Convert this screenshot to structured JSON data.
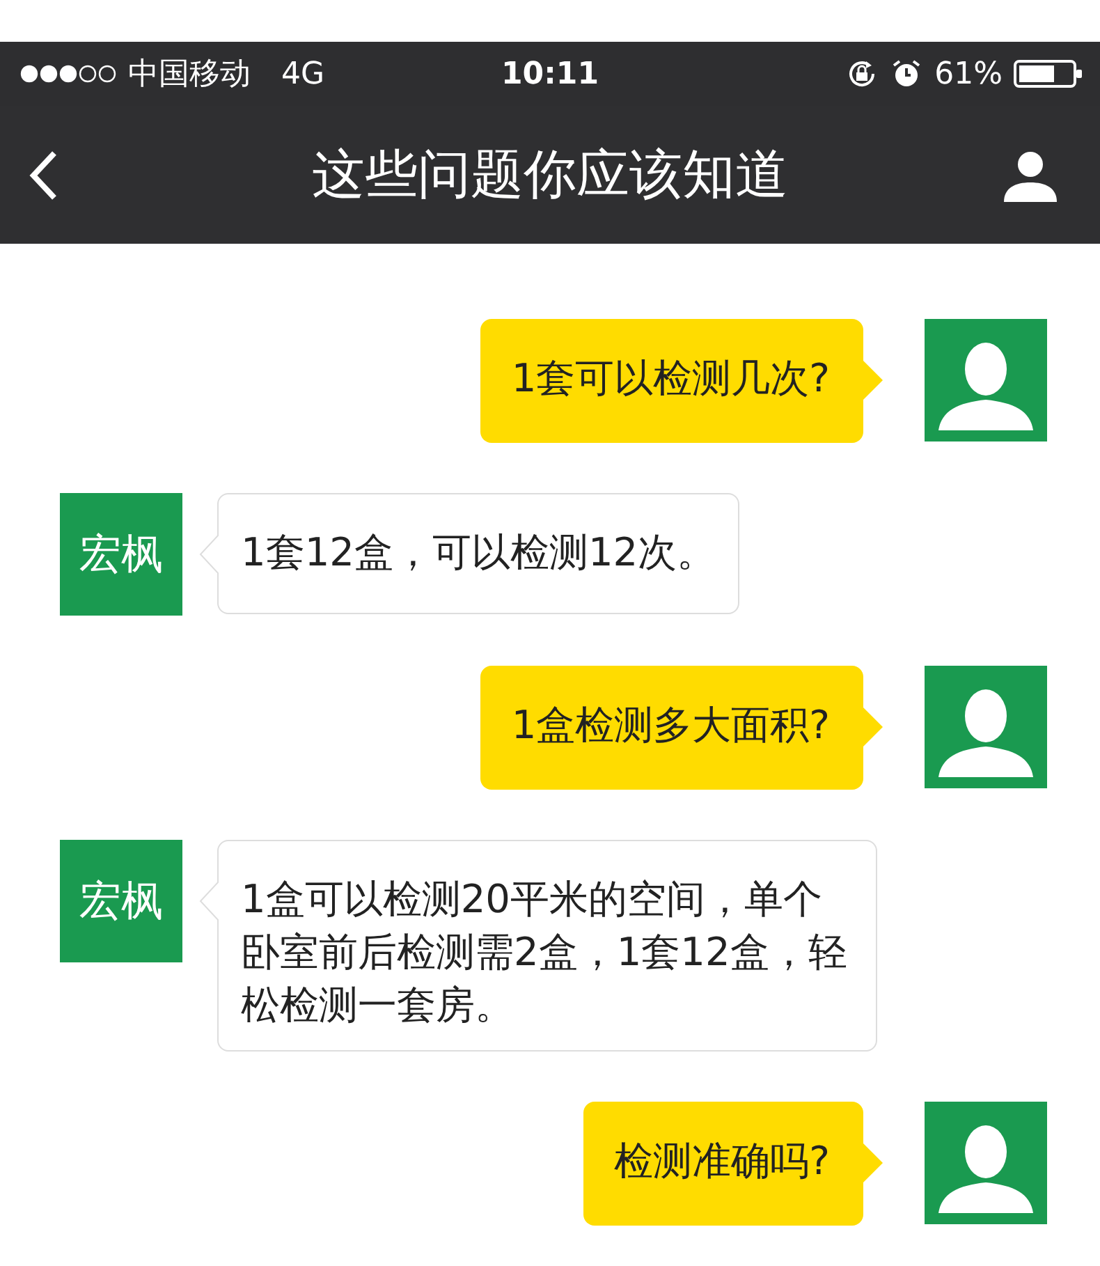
{
  "status_bar": {
    "carrier": "中国移动",
    "network": "4G",
    "time": "10:11",
    "battery": "61%"
  },
  "nav_bar": {
    "title": "这些问题你应该知道"
  },
  "messages": [
    {
      "kind": "user",
      "text": "1套可以检测几次?"
    },
    {
      "kind": "bot",
      "avatar": "宏枫",
      "text": "1套12盒，可以检测12次。"
    },
    {
      "kind": "user",
      "text": "1盒检测多大面积?"
    },
    {
      "kind": "bot",
      "avatar": "宏枫",
      "text": "1盒可以检测20平米的空间，单个卧室前后检测需2盒，1套12盒，轻松检测一套房。"
    },
    {
      "kind": "user",
      "text": "检测准确吗?"
    }
  ]
}
